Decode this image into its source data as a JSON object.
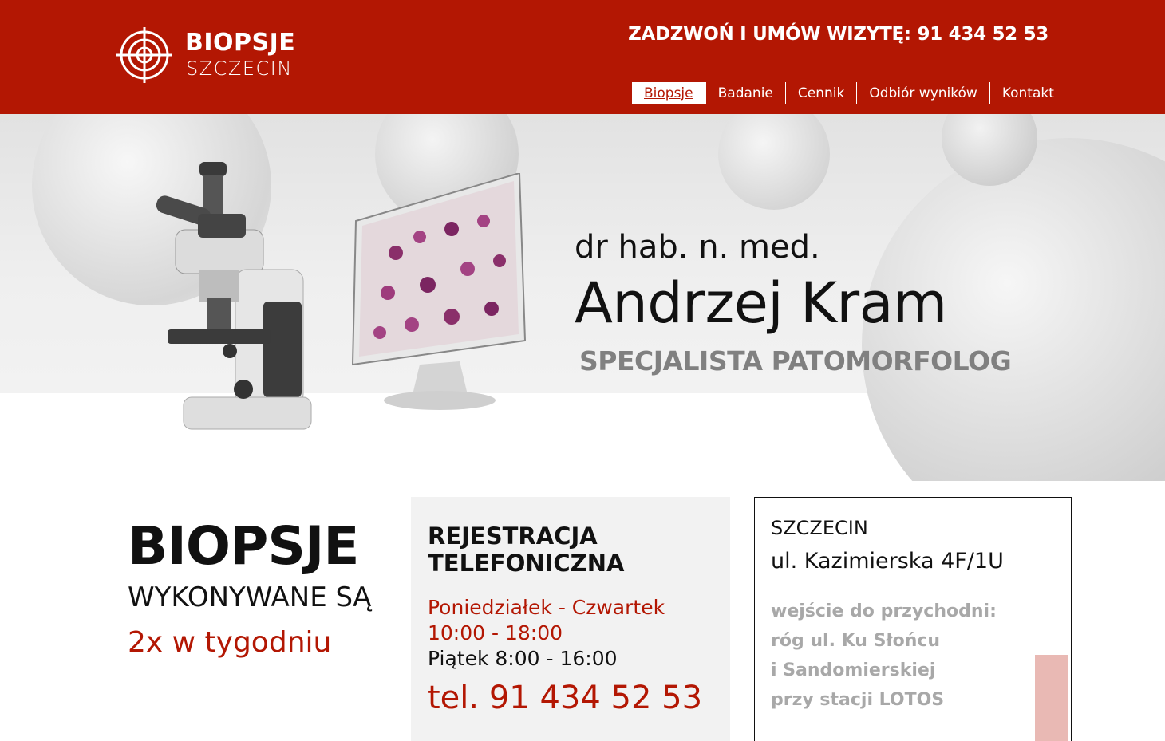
{
  "header": {
    "logo_line1": "BIOPSJE",
    "logo_line2": "SZCZECIN",
    "phone_cta": "ZADZWOŃ I UMÓW WIZYTĘ: 91 434 52 53",
    "nav": [
      {
        "label": "Biopsje",
        "active": true
      },
      {
        "label": "Badanie"
      },
      {
        "label": "Cennik"
      },
      {
        "label": "Odbiór wyników"
      },
      {
        "label": "Kontakt"
      }
    ]
  },
  "hero": {
    "title_prefix": "dr hab. n. med.",
    "name": "Andrzej Kram",
    "specialty": "SPECJALISTA PATOMORFOLOG"
  },
  "biopsy": {
    "title": "BIOPSJE",
    "line1": "WYKONYWANE SĄ",
    "line2": "2x w tygodniu"
  },
  "registration": {
    "title": "REJESTRACJA TELEFONICZNA",
    "hours_days": "Poniedziałek - Czwartek",
    "hours_time": "10:00 - 18:00",
    "friday": "Piątek 8:00 - 16:00",
    "phone": "tel. 91 434 52 53"
  },
  "address": {
    "city": "SZCZECIN",
    "street": "ul. Kazimierska 4F/1U",
    "note_lines": [
      "wejście do przychodni:",
      "róg ul. Ku Słońcu",
      "i Sandomierskiej",
      "przy stacji LOTOS"
    ]
  },
  "colors": {
    "brand": "#b31703",
    "panel": "#f2f2f2",
    "muted": "#a8a8a8",
    "accent_pink": "#e9b9b4"
  },
  "icons": {
    "logo": "crosshair-target-icon"
  }
}
